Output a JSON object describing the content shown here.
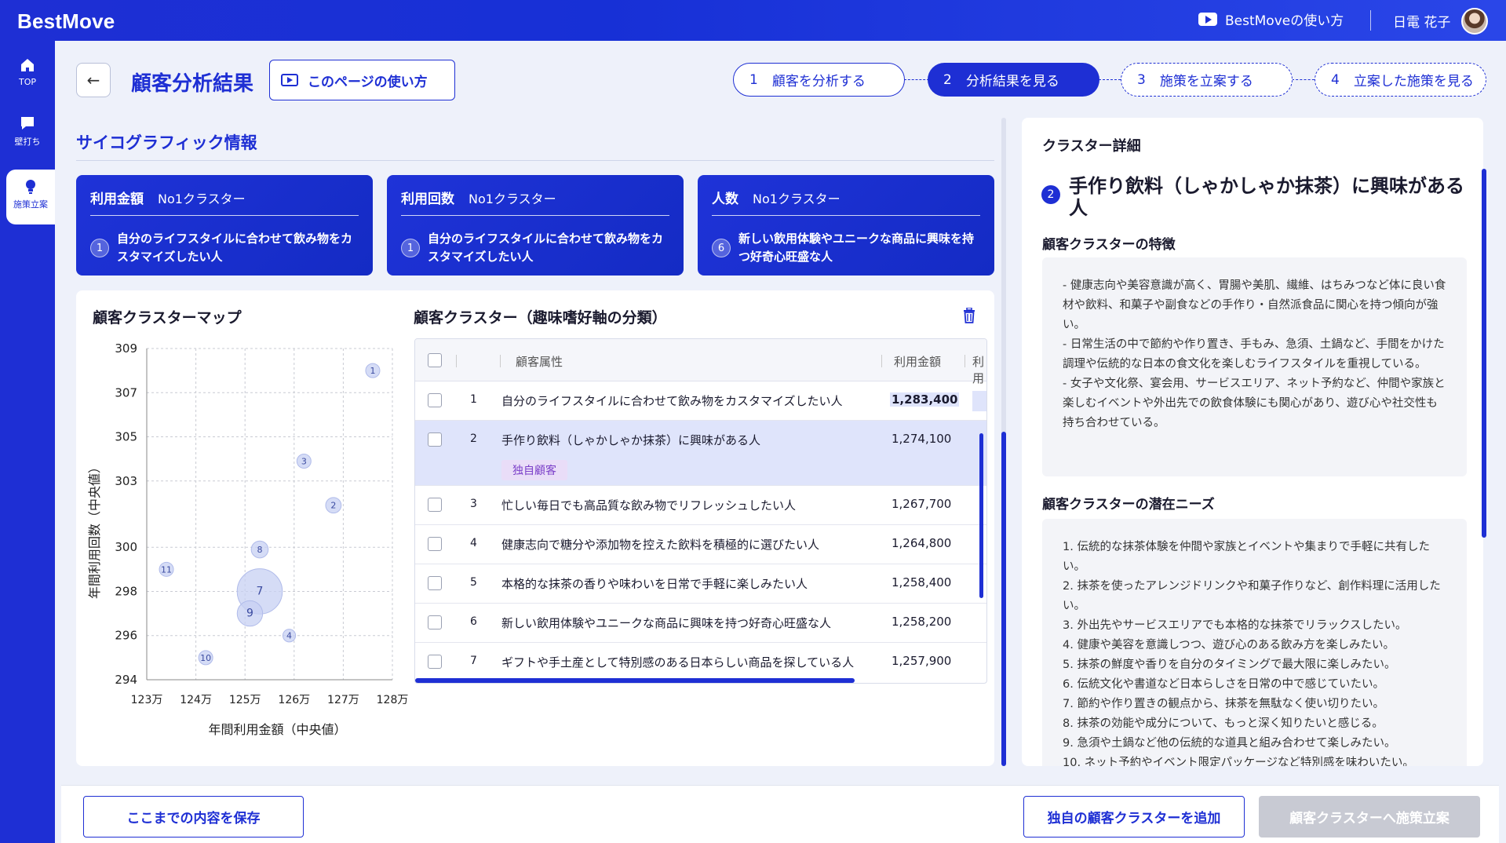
{
  "app": {
    "logo": "BestMove",
    "help_link": "BestMoveの使い方",
    "user_name": "日電 花子"
  },
  "sidebar": {
    "items": [
      {
        "label": "TOP",
        "icon": "home-icon"
      },
      {
        "label": "壁打ち",
        "icon": "chat-icon"
      },
      {
        "label": "施策立案",
        "icon": "lightbulb-icon",
        "active": true
      }
    ]
  },
  "page": {
    "title": "顧客分析結果",
    "help_button": "このページの使い方"
  },
  "steps": [
    {
      "num": "1",
      "label": "顧客を分析する",
      "state": "done"
    },
    {
      "num": "2",
      "label": "分析結果を見る",
      "state": "current"
    },
    {
      "num": "3",
      "label": "施策を立案する",
      "state": "todo"
    },
    {
      "num": "4",
      "label": "立案した施策を見る",
      "state": "todo"
    }
  ],
  "psychographic": {
    "heading": "サイコグラフィック情報",
    "cards": [
      {
        "metric": "利用金額",
        "rank": "No1クラスター",
        "num": "1",
        "text": "自分のライフスタイルに合わせて飲み物をカスタマイズしたい人"
      },
      {
        "metric": "利用回数",
        "rank": "No1クラスター",
        "num": "1",
        "text": "自分のライフスタイルに合わせて飲み物をカスタマイズしたい人"
      },
      {
        "metric": "人数",
        "rank": "No1クラスター",
        "num": "6",
        "text": "新しい飲用体験やユニークな商品に興味を持つ好奇心旺盛な人"
      }
    ]
  },
  "map": {
    "title": "顧客クラスターマップ"
  },
  "chart_data": {
    "type": "scatter",
    "title": "顧客クラスターマップ",
    "xlabel": "年間利用金額（中央値）",
    "ylabel": "年間利用回数（中央値）",
    "xlim": [
      123,
      128
    ],
    "ylim": [
      294,
      309
    ],
    "xticks": [
      "123万",
      "124万",
      "125万",
      "126万",
      "127万",
      "128万"
    ],
    "yticks": [
      "309",
      "307",
      "305",
      "303",
      "300",
      "298",
      "296",
      "294"
    ],
    "grid": true,
    "points": [
      {
        "label": "1",
        "x": 127.6,
        "y": 308.0,
        "size": 1
      },
      {
        "label": "2",
        "x": 126.8,
        "y": 301.9,
        "size": 1.1
      },
      {
        "label": "3",
        "x": 126.2,
        "y": 303.9,
        "size": 1
      },
      {
        "label": "4",
        "x": 125.9,
        "y": 296.0,
        "size": 0.9
      },
      {
        "label": "8",
        "x": 125.3,
        "y": 299.9,
        "size": 1.2
      },
      {
        "label": "7",
        "x": 125.3,
        "y": 298.0,
        "size": 3.2
      },
      {
        "label": "9",
        "x": 125.1,
        "y": 297.0,
        "size": 1.8
      },
      {
        "label": "10",
        "x": 124.2,
        "y": 295.0,
        "size": 1
      },
      {
        "label": "11",
        "x": 123.4,
        "y": 299.0,
        "size": 1
      }
    ]
  },
  "table": {
    "title": "顧客クラスター（趣味嗜好軸の分類）",
    "columns": [
      "顧客属性",
      "利用金額",
      "利用"
    ],
    "rows": [
      {
        "num": "1",
        "attr": "自分のライフスタイルに合わせて飲み物をカスタマイズしたい人",
        "amount": "1,283,400"
      },
      {
        "num": "2",
        "attr": "手作り飲料（しゃかしゃか抹茶）に興味がある人",
        "amount": "1,274,100",
        "badge": "独自顧客"
      },
      {
        "num": "3",
        "attr": "忙しい毎日でも高品質な飲み物でリフレッシュしたい人",
        "amount": "1,267,700"
      },
      {
        "num": "4",
        "attr": "健康志向で糖分や添加物を控えた飲料を積極的に選びたい人",
        "amount": "1,264,800"
      },
      {
        "num": "5",
        "attr": "本格的な抹茶の香りや味わいを日常で手軽に楽しみたい人",
        "amount": "1,258,400"
      },
      {
        "num": "6",
        "attr": "新しい飲用体験やユニークな商品に興味を持つ好奇心旺盛な人",
        "amount": "1,258,200"
      },
      {
        "num": "7",
        "attr": "ギフトや手土産として特別感のある日本らしい商品を探している人",
        "amount": "1,257,900"
      }
    ]
  },
  "detail": {
    "title": "クラスター詳細",
    "num": "2",
    "name": "手作り飲料（しゃかしゃか抹茶）に興味がある人",
    "features_heading": "顧客クラスターの特徴",
    "features": [
      "- 健康志向や美容意識が高く、胃腸や美肌、繊維、はちみつなど体に良い食材や飲料、和菓子や副食などの手作り・自然派食品に関心を持つ傾向が強い。",
      "- 日常生活の中で節約や作り置き、手もみ、急須、土鍋など、手間をかけた調理や伝統的な日本の食文化を楽しむライフスタイルを重視している。",
      "- 女子や文化祭、宴会用、サービスエリア、ネット予約など、仲間や家族と楽しむイベントや外出先での飲食体験にも関心があり、遊び心や社交性も持ち合わせている。"
    ],
    "needs_heading": "顧客クラスターの潜在ニーズ",
    "needs": [
      "1. 伝統的な抹茶体験を仲間や家族とイベントや集まりで手軽に共有したい。",
      "2. 抹茶を使ったアレンジドリンクや和菓子作りなど、創作料理に活用したい。",
      "3. 外出先やサービスエリアでも本格的な抹茶でリラックスしたい。",
      "4. 健康や美容を意識しつつ、遊び心のある飲み方を楽しみたい。",
      "5. 抹茶の鮮度や香りを自分のタイミングで最大限に楽しみたい。",
      "6. 伝統文化や書道など日本らしさを日常の中で感じていたい。",
      "7. 節約や作り置きの観点から、抹茶を無駄なく使い切りたい。",
      "8. 抹茶の効能や成分について、もっと深く知りたいと感じる。",
      "9. 急須や土鍋など他の伝統的な道具と組み合わせて楽しみたい。",
      "10. ネット予約やイベント限定パッケージなど特別感を味わいたい。"
    ]
  },
  "footer": {
    "save": "ここまでの内容を保存",
    "add": "独自の顧客クラスターを追加",
    "plan": "顧客クラスターへ施策立案"
  }
}
